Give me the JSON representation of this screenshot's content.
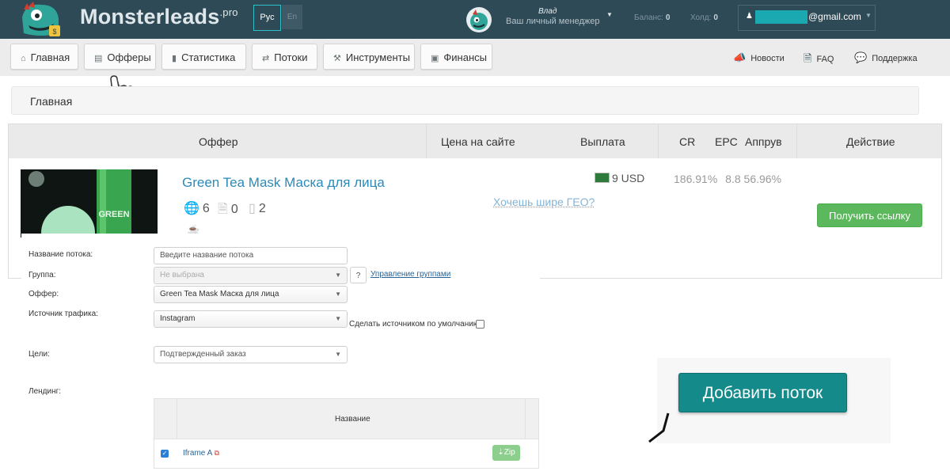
{
  "header": {
    "brand": "Monsterleads",
    "brand_suffix": ".pro",
    "lang_active": "Рус",
    "lang_other": "En",
    "manager_name": "Влад",
    "manager_role": "Ваш личный менеджер",
    "balance_label": "Баланс:",
    "balance_value": "0",
    "hold_label": "Холд:",
    "hold_value": "0",
    "account_email": "@gmail.com",
    "colors": {
      "topbar": "#2e4a57",
      "accent": "#2fc1c9"
    }
  },
  "nav": {
    "items": [
      {
        "label": "Главная",
        "icon": "home-icon"
      },
      {
        "label": "Офферы",
        "icon": "list-icon"
      },
      {
        "label": "Статистика",
        "icon": "bar-chart-icon"
      },
      {
        "label": "Потоки",
        "icon": "shuffle-icon"
      },
      {
        "label": "Инструменты",
        "icon": "wrench-icon"
      },
      {
        "label": "Финансы",
        "icon": "briefcase-icon"
      }
    ],
    "right": [
      {
        "label": "Новости",
        "icon": "megaphone-icon"
      },
      {
        "label": "FAQ",
        "icon": "document-icon"
      },
      {
        "label": "Поддержка",
        "icon": "chat-bubble-icon"
      }
    ]
  },
  "breadcrumb": {
    "current": "Главная"
  },
  "offers_table": {
    "headers": {
      "offer": "Оффер",
      "site_price": "Цена на сайте",
      "payout": "Выплата",
      "cr": "CR",
      "epc": "EPC",
      "approve": "Аппрув",
      "action": "Действие"
    },
    "row": {
      "title": "Green Tea Mask Маска для лица",
      "geo_count": "6",
      "landings_count": "0",
      "mobile_count": "2",
      "payout": "9 USD",
      "geo_link": "Хочешь шире ГЕО?",
      "cr": "186.91%",
      "epc": "8.8",
      "approve": "56.96%",
      "action_label": "Получить ссылку",
      "image_text": "GREEN"
    }
  },
  "stream_form": {
    "name_label": "Название потока:",
    "name_placeholder": "Введите название потока",
    "group_label": "Группа:",
    "group_value": "Не выбрана",
    "help_label": "?",
    "manage_groups": "Управление группами",
    "offer_label": "Оффер:",
    "offer_value": "Green Tea Mask Маска для лица",
    "source_label": "Источник трафика:",
    "source_value": "Instagram",
    "default_source_label": "Сделать источником по умолчанию",
    "goals_label": "Цели:",
    "goals_value": "Подтвержденный заказ",
    "landing_label": "Лендинг:",
    "landing_table_header": "Название",
    "landing_row_name": "Iframe A",
    "zip_label": "Zip"
  },
  "add_stream": {
    "label": "Добавить поток"
  }
}
